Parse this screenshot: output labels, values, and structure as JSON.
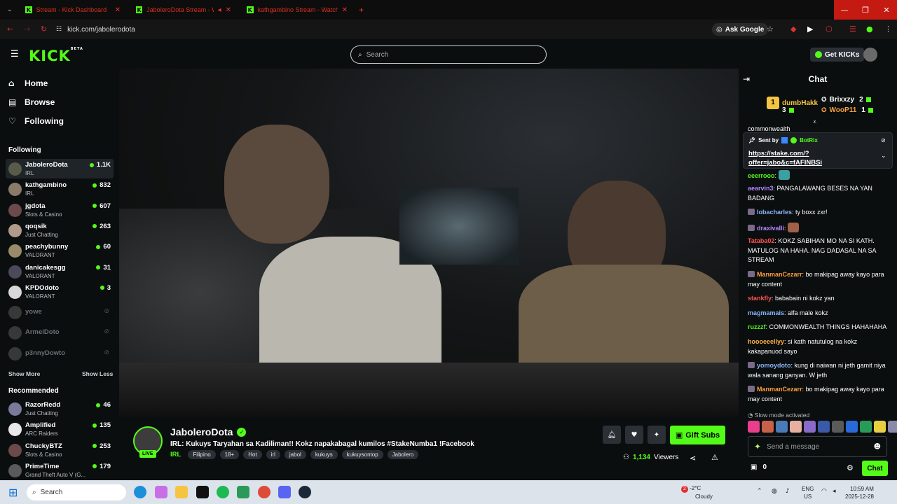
{
  "browser": {
    "tabs": [
      {
        "title": "Stream - Kick Dashboard"
      },
      {
        "title": "JaboleroDota Stream - Wa"
      },
      {
        "title": "kathgambino Stream - Watch"
      }
    ],
    "url": "kick.com/jabolerodota",
    "ask_google": "Ask Google"
  },
  "header": {
    "logo": "KICK",
    "logo_badge": "BETA",
    "search_placeholder": "Search",
    "get_kicks": "Get KICKs"
  },
  "sidebar": {
    "nav": [
      {
        "label": "Home",
        "icon": "home-icon"
      },
      {
        "label": "Browse",
        "icon": "browse-icon"
      },
      {
        "label": "Following",
        "icon": "heart-icon"
      }
    ],
    "following_title": "Following",
    "following": [
      {
        "name": "JaboleroDota",
        "category": "IRL",
        "viewers": "1.1K",
        "live": true,
        "color": "#5a5a4a"
      },
      {
        "name": "kathgambino",
        "category": "IRL",
        "viewers": "832",
        "live": true,
        "color": "#8a7a6a"
      },
      {
        "name": "jgdota",
        "category": "Slots & Casino",
        "viewers": "607",
        "live": true,
        "color": "#6a4a4a"
      },
      {
        "name": "qoqsik",
        "category": "Just Chatting",
        "viewers": "263",
        "live": true,
        "color": "#b09a8a"
      },
      {
        "name": "peachybunny",
        "category": "VALORANT",
        "viewers": "60",
        "live": true,
        "color": "#9a8a6a"
      },
      {
        "name": "danicakesgg",
        "category": "VALORANT",
        "viewers": "31",
        "live": true,
        "color": "#4a4a5a"
      },
      {
        "name": "KPDOdoto",
        "category": "VALORANT",
        "viewers": "3",
        "live": true,
        "color": "#d8d8d8"
      },
      {
        "name": "yowe",
        "live": false,
        "color": "#8a8a8a"
      },
      {
        "name": "ArmelDoto",
        "live": false,
        "color": "#8a8a8a"
      },
      {
        "name": "p3nnyDowto",
        "live": false,
        "color": "#8a8a8a"
      }
    ],
    "show_more": "Show More",
    "show_less": "Show Less",
    "recommended_title": "Recommended",
    "recommended": [
      {
        "name": "RazorRedd",
        "category": "Just Chatting",
        "viewers": "46",
        "color": "#7a7a9a"
      },
      {
        "name": "Amplified",
        "category": "ARC Raiders",
        "viewers": "135",
        "color": "#e8e8e8"
      },
      {
        "name": "ChuckyBTZ",
        "category": "Slots & Casino",
        "viewers": "253",
        "color": "#6a4a4a"
      },
      {
        "name": "PrimeTime",
        "category": "Grand Theft Auto V (G...",
        "viewers": "179",
        "color": "#5a5a5a"
      }
    ]
  },
  "stream": {
    "channel": "JaboleroDota",
    "live_label": "LIVE",
    "title": "IRL: Kukuys Taryahan sa Kadiliman!! Kokz napakabagal kumilos #StakeNumba1 !Facebook",
    "category": "IRL",
    "tags": [
      "Filipino",
      "18+",
      "Hot",
      "irl",
      "jabol",
      "kukuys",
      "kukuysontop",
      "Jabolero"
    ],
    "gift_subs": "Gift Subs",
    "viewers": "1,134",
    "viewers_label": "Viewers"
  },
  "chat": {
    "title": "Chat",
    "leaders": [
      {
        "rank": "1",
        "name": "dumbHakk",
        "count": "3",
        "color": "#f5c542"
      },
      {
        "name": "Brixxzy",
        "count": "2",
        "color": "#ffffff"
      },
      {
        "name": "WooP11",
        "count": "1",
        "color": "#f5a142"
      }
    ],
    "clipped_line": "commonwealth",
    "pinned": {
      "sent_by": "Sent by",
      "bot": "BotRix",
      "link": "https://stake.com/?offer=jabo&c=fAFINBSi"
    },
    "messages": [
      {
        "user": "eeerrooo",
        "text": "",
        "color": "#53fc18"
      },
      {
        "user": "aearvin3",
        "text": "PANGALAWANG BESES NA YAN BADANG",
        "color": "#b388ff"
      },
      {
        "user": "lobacharles",
        "text": "ty boxx zxr!",
        "color": "#8ab4f8"
      },
      {
        "user": "draxivalli",
        "text": "",
        "color": "#b388ff"
      },
      {
        "user": "Tataba02",
        "text": "KOKZ SABIHAN MO NA SI KATH. MATULOG NA HAHA. NAG DADASAL NA SA STREAM",
        "color": "#ff5252"
      },
      {
        "user": "ManmanCezarr",
        "text": "bo makipag away kayo para may content",
        "color": "#ff9d3d"
      },
      {
        "user": "stankfly",
        "text": "bababain ni kokz yan",
        "color": "#ff5252"
      },
      {
        "user": "magmamais",
        "text": "alfa male kokz",
        "color": "#8ab4f8"
      },
      {
        "user": "ruzzzf",
        "text": "COMMONWEALTH THINGS HAHAHAHA",
        "color": "#53fc18"
      },
      {
        "user": "hoooeeellyy",
        "text": "si kath natutulog na kokz kakapanuod sayo",
        "color": "#ffb347"
      },
      {
        "user": "yomoydoto",
        "text": "kung di naiwan ni jeth gamit niya wala sanang ganyan. W jeth",
        "color": "#8ab4f8"
      },
      {
        "user": "ManmanCezarr",
        "text": "bo makipag away kayo para may content",
        "color": "#ff9d3d"
      }
    ],
    "slow_mode": "Slow mode activated",
    "input_placeholder": "Send a message",
    "kicks_count": "0",
    "send_label": "Chat"
  },
  "taskbar": {
    "search": "Search",
    "weather_temp": "-2°C",
    "weather_desc": "Cloudy",
    "weather_badge": "2",
    "lang": "ENG",
    "region": "US",
    "time": "10:59 AM",
    "date": "2025-12-28"
  }
}
